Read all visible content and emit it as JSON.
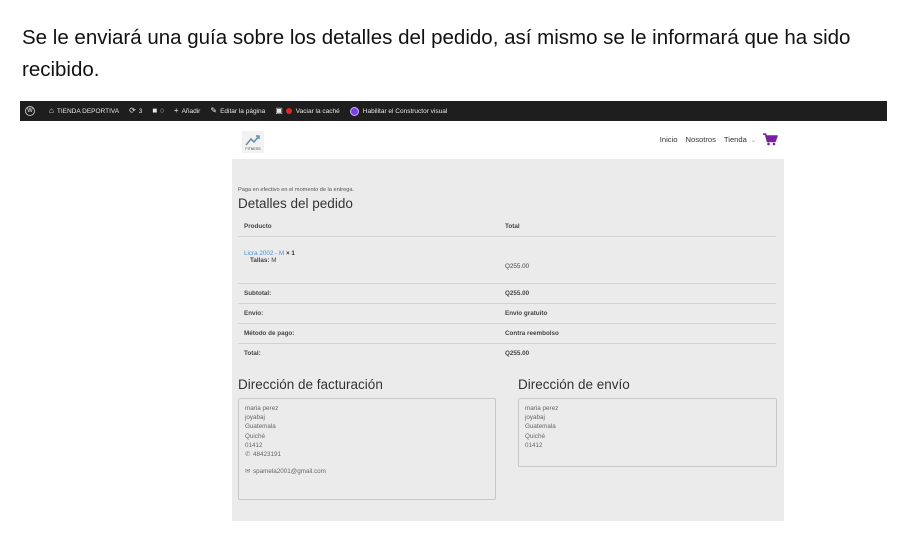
{
  "caption": "Se le enviará una guía sobre los detalles del pedido, así mismo se le informará que ha sido recibido.",
  "admin_bar": {
    "site_name": "TIENDA DEPORTIVA",
    "updates_count": "3",
    "comments_count": "0",
    "add_label": "Añadir",
    "edit_label": "Editar la página",
    "cache_label": "Vaciar la caché",
    "builder_label": "Habilitar el Constructor visual"
  },
  "header": {
    "logo_text": "FITNESS",
    "nav": [
      "Inicio",
      "Nosotros",
      "Tienda"
    ],
    "store_chevron": "⌄",
    "cart_color": "#7b1fa2"
  },
  "order": {
    "notice": "Paga en efectivo en el momento de la entrega.",
    "details_title": "Detalles del pedido",
    "col_product": "Producto",
    "col_total": "Total",
    "product_name": "Licra 2002 - M",
    "product_qty": "× 1",
    "meta_key": "Tallas:",
    "meta_value": "M",
    "product_total": "Q255.00",
    "rows": [
      {
        "label": "Subtotal:",
        "value": "Q255.00"
      },
      {
        "label": "Envío:",
        "value": "Envío gratuito"
      },
      {
        "label": "Método de pago:",
        "value": "Contra reembolso"
      },
      {
        "label": "Total:",
        "value": "Q255.00"
      }
    ]
  },
  "billing": {
    "title": "Dirección de facturación",
    "lines": [
      "maria perez",
      "joyabaj",
      "Guatemala",
      "Quiché",
      "01412"
    ],
    "phone": "48423191",
    "email": "spamela2001@gmail.com"
  },
  "shipping": {
    "title": "Dirección de envío",
    "lines": [
      "maria perez",
      "joyabaj",
      "Guatemala",
      "Quiché",
      "01412"
    ]
  }
}
